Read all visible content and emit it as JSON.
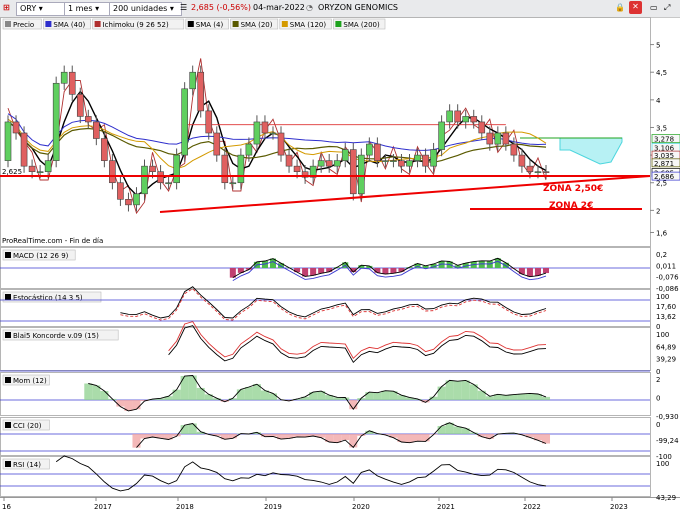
{
  "toolbar": {
    "symbol": "ORY",
    "timeframe": "1 mes",
    "units": "200 unidades",
    "price_change": "2,685 (-0,56%)",
    "date": "04-mar-2022",
    "name": "ORYZON GENOMICS"
  },
  "legend": [
    "Precio",
    "SMA (40)",
    "Ichimoku (9 26 52)",
    "SMA (4)",
    "SMA (20)",
    "SMA (120)",
    "SMA (200)"
  ],
  "legend_colors": [
    "#888888",
    "#2f2fcc",
    "#b03030",
    "#000000",
    "#5a5a00",
    "#d49a00",
    "#1fa31f"
  ],
  "price_panel": {
    "y_ticks": [
      "5",
      "4,5",
      "4",
      "3,5",
      "3",
      "2,5",
      "2",
      "1,6"
    ],
    "left_value": "2,625",
    "right_labels": [
      "3,278",
      "3,106",
      "3,035",
      "2,871",
      "2,685",
      "2,686"
    ],
    "zone1": "ZONA 2,50€",
    "zone2": "ZONA 2€",
    "source": "ProRealTime.com - Fin de día"
  },
  "indicators": [
    {
      "name": "MACD (12 26 9)",
      "ticks": [
        "0,2",
        "0,011",
        "-0,076",
        "-0,086"
      ]
    },
    {
      "name": "Estocástico (14 3 5)",
      "ticks": [
        "100",
        "17,60",
        "13,62",
        "0"
      ]
    },
    {
      "name": "Blai5 Koncorde v.09 (15)",
      "ticks": [
        "100",
        "64,89",
        "39,29",
        "0"
      ]
    },
    {
      "name": "Mom (12)",
      "ticks": [
        "2",
        "0",
        "-0,930"
      ]
    },
    {
      "name": "CCI (20)",
      "ticks": [
        "0",
        "-99,24",
        "-100"
      ]
    },
    {
      "name": "RSI (14)",
      "ticks": [
        "100",
        "43,29"
      ]
    }
  ],
  "x_axis": [
    "16",
    "2017",
    "2018",
    "2019",
    "2020",
    "2021",
    "2022",
    "2023"
  ],
  "chart_data": {
    "type": "candlestick",
    "x": [
      "2016-08",
      "2016-09",
      "2016-10",
      "2016-11",
      "2016-12",
      "2017-01",
      "2017-02",
      "2017-03",
      "2017-04",
      "2017-05",
      "2017-06",
      "2017-07",
      "2017-08",
      "2017-09",
      "2017-10",
      "2017-11",
      "2017-12",
      "2018-01",
      "2018-02",
      "2018-03",
      "2018-04",
      "2018-05",
      "2018-06",
      "2018-07",
      "2018-08",
      "2018-09",
      "2018-10",
      "2018-11",
      "2018-12",
      "2019-01",
      "2019-02",
      "2019-03",
      "2019-04",
      "2019-05",
      "2019-06",
      "2019-07",
      "2019-08",
      "2019-09",
      "2019-10",
      "2019-11",
      "2019-12",
      "2020-01",
      "2020-02",
      "2020-03",
      "2020-04",
      "2020-05",
      "2020-06",
      "2020-07",
      "2020-08",
      "2020-09",
      "2020-10",
      "2020-11",
      "2020-12",
      "2021-01",
      "2021-02",
      "2021-03",
      "2021-04",
      "2021-05",
      "2021-06",
      "2021-07",
      "2021-08",
      "2021-09",
      "2021-10",
      "2021-11",
      "2021-12",
      "2022-01",
      "2022-02",
      "2022-03"
    ],
    "open": [
      2.9,
      3.6,
      3.4,
      2.8,
      2.7,
      2.7,
      2.9,
      4.3,
      4.5,
      4.1,
      3.7,
      3.6,
      3.3,
      2.9,
      2.5,
      2.2,
      2.1,
      2.3,
      2.8,
      2.7,
      2.5,
      2.5,
      3.0,
      4.2,
      4.5,
      3.8,
      3.4,
      3.0,
      2.5,
      2.5,
      3.0,
      3.2,
      3.6,
      3.4,
      3.4,
      3.0,
      2.8,
      2.7,
      2.6,
      2.8,
      2.9,
      2.8,
      2.9,
      3.1,
      2.3,
      3.0,
      3.2,
      2.9,
      2.9,
      2.9,
      2.8,
      2.9,
      3.0,
      2.8,
      3.1,
      3.6,
      3.8,
      3.6,
      3.7,
      3.6,
      3.4,
      3.2,
      3.4,
      3.2,
      3.0,
      2.8,
      2.7,
      2.7
    ],
    "close": [
      3.6,
      3.4,
      2.8,
      2.7,
      2.7,
      2.9,
      4.3,
      4.5,
      4.1,
      3.7,
      3.6,
      3.3,
      2.9,
      2.5,
      2.2,
      2.1,
      2.3,
      2.8,
      2.7,
      2.5,
      2.5,
      3.0,
      4.2,
      4.5,
      3.8,
      3.4,
      3.0,
      2.5,
      2.5,
      3.0,
      3.2,
      3.6,
      3.4,
      3.4,
      3.0,
      2.8,
      2.7,
      2.6,
      2.8,
      2.9,
      2.8,
      2.9,
      3.1,
      2.3,
      3.0,
      3.2,
      2.9,
      2.9,
      2.9,
      2.8,
      2.9,
      3.0,
      2.8,
      3.1,
      3.6,
      3.8,
      3.6,
      3.7,
      3.6,
      3.4,
      3.2,
      3.4,
      3.2,
      3.0,
      2.8,
      2.7,
      2.7,
      2.685
    ],
    "ylim": [
      1.5,
      5.3
    ],
    "overlays": {
      "support_line": {
        "from": [
          "2017-11",
          2.0
        ],
        "to": [
          "2022-05",
          2.5
        ]
      },
      "zone_2_50": 2.5,
      "zone_2": 2.0
    }
  }
}
